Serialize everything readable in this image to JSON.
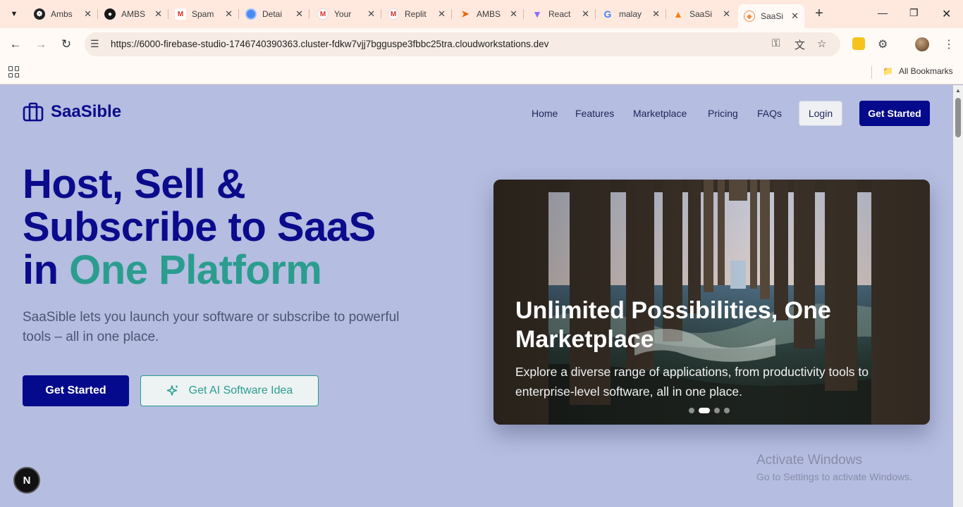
{
  "browser": {
    "tabs": [
      {
        "title": "Ambs",
        "icon": "openai-icon"
      },
      {
        "title": "AMBS",
        "icon": "github-icon"
      },
      {
        "title": "Spam",
        "icon": "gmail-icon"
      },
      {
        "title": "Detai",
        "icon": "chrome-web-icon"
      },
      {
        "title": "Your",
        "icon": "gmail-icon"
      },
      {
        "title": "Replit",
        "icon": "gmail-icon"
      },
      {
        "title": "AMBS",
        "icon": "replit-icon"
      },
      {
        "title": "React",
        "icon": "vite-icon"
      },
      {
        "title": "malay",
        "icon": "google-icon"
      },
      {
        "title": "SaaSi",
        "icon": "firebase-icon"
      },
      {
        "title": "SaaSi",
        "icon": "firebase-studio-icon"
      }
    ],
    "active_tab_index": 10,
    "url": "https://6000-firebase-studio-1746740390363.cluster-fdkw7vjj7bgguspe3fbbc25tra.cloudworkstations.dev",
    "bookmarks_label": "All Bookmarks"
  },
  "site": {
    "brand": "SaaSible",
    "nav": [
      "Home",
      "Features",
      "Marketplace",
      "Pricing",
      "FAQs"
    ],
    "login_label": "Login",
    "get_started_label": "Get Started"
  },
  "hero": {
    "title_line1": "Host, Sell &",
    "title_line2": "Subscribe to SaaS",
    "title_line3_prefix": "in",
    "title_line3_accent": "One Platform",
    "subtitle": "SaaSible lets you launch your software or subscribe to powerful tools – all in one place.",
    "primary_button": "Get Started",
    "secondary_button": "Get AI Software Idea"
  },
  "carousel": {
    "slide_title": "Unlimited Possibilities, One Marketplace",
    "slide_description": "Explore a diverse range of applications, from productivity tools to enterprise-level software, all in one place.",
    "slide_count": 4,
    "active_slide": 1
  },
  "overlay": {
    "dev_badge": "N",
    "activate_title": "Activate Windows",
    "activate_sub": "Go to Settings to activate Windows."
  },
  "colors": {
    "page_bg": "#b5bde0",
    "brand_navy": "#050a8c",
    "accent_teal": "#2a9d8f",
    "chrome_tab_bg": "#ffe9df"
  }
}
